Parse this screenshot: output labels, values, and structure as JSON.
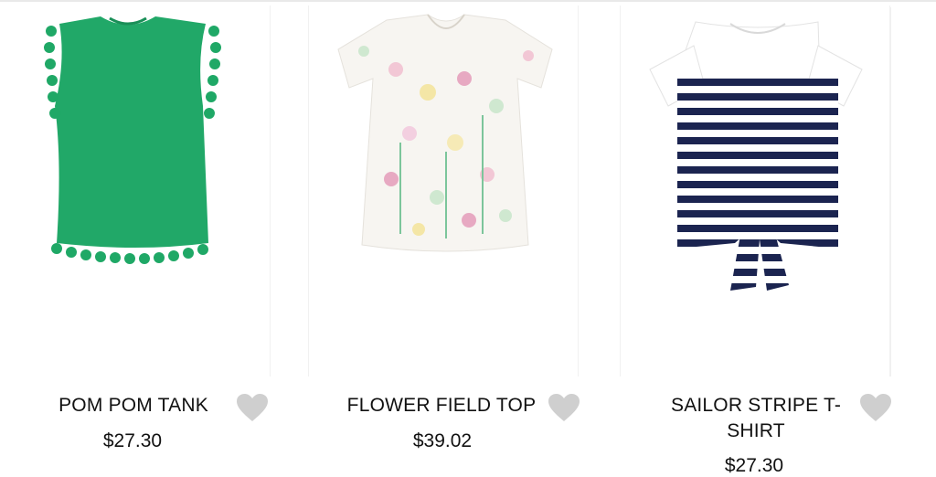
{
  "products": [
    {
      "name": "POM POM TANK",
      "price": "$27.30",
      "color": "#1fa866"
    },
    {
      "name": "FLOWER FIELD TOP",
      "price": "$39.02",
      "color": "#f6f4f0"
    },
    {
      "name": "SAILOR STRIPE T-SHIRT",
      "price": "$27.30",
      "color": "#1b2450"
    }
  ],
  "icons": {
    "wishlist": "heart-icon"
  },
  "colors": {
    "heart": "#cfcfcf",
    "text": "#111111"
  }
}
